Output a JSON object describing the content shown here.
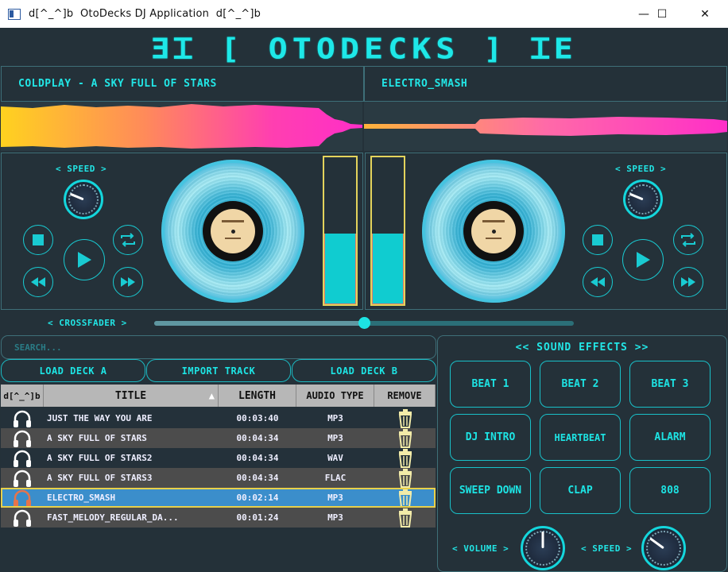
{
  "window": {
    "title": "d[^_^]b  OtoDecks DJ Application  d[^_^]b",
    "minimize_icon": "—",
    "maximize_icon": "☐",
    "close_icon": "✕"
  },
  "banner": {
    "logo": "ƎꞮ [ OTODECKS ] ꞮE"
  },
  "deck_a": {
    "track_title": "COLDPLAY - A SKY FULL OF STARS",
    "speed_label": "< SPEED >",
    "speed_level": 0.25
  },
  "deck_b": {
    "track_title": "ELECTRO_SMASH",
    "speed_label": "< SPEED >",
    "speed_level": 0.25
  },
  "meters": {
    "left_level": 0.48,
    "right_level": 0.48
  },
  "crossfader": {
    "label": "< CROSSFADER >",
    "position": 0.5
  },
  "search": {
    "placeholder": "SEARCH..."
  },
  "buttons": {
    "load_deck_a": "LOAD DECK A",
    "import_track": "IMPORT TRACK",
    "load_deck_b": "LOAD DECK B"
  },
  "playlist": {
    "columns": [
      "d[^_^]b",
      "TITLE",
      "LENGTH",
      "AUDIO TYPE",
      "REMOVE"
    ],
    "sort_indicator": "▲",
    "rows": [
      {
        "title": "JUST THE WAY YOU ARE",
        "length": "00:03:40",
        "type": "MP3"
      },
      {
        "title": "A SKY FULL OF STARS",
        "length": "00:04:34",
        "type": "MP3"
      },
      {
        "title": "A SKY FULL OF STARS2",
        "length": "00:04:34",
        "type": "WAV"
      },
      {
        "title": "A SKY FULL OF STARS3",
        "length": "00:04:34",
        "type": "FLAC"
      },
      {
        "title": "ELECTRO_SMASH",
        "length": "00:02:14",
        "type": "MP3"
      },
      {
        "title": "FAST_MELODY_REGULAR_DA...",
        "length": "00:01:24",
        "type": "MP3"
      }
    ],
    "selected_index": 4
  },
  "sound_effects": {
    "title": "<< SOUND EFFECTS >>",
    "buttons": [
      "BEAT 1",
      "BEAT 2",
      "BEAT 3",
      "DJ INTRO",
      "HEARTBEAT",
      "ALARM",
      "SWEEP DOWN",
      "CLAP",
      "808"
    ],
    "volume_label": "< VOLUME >",
    "speed_label": "< SPEED >",
    "volume_level": 0.5,
    "speed_level": 0.3
  },
  "colors": {
    "accent": "#1de4e4",
    "background": "#243139",
    "meter_border": "#e3d35c",
    "selection": "#3b8ecb"
  }
}
